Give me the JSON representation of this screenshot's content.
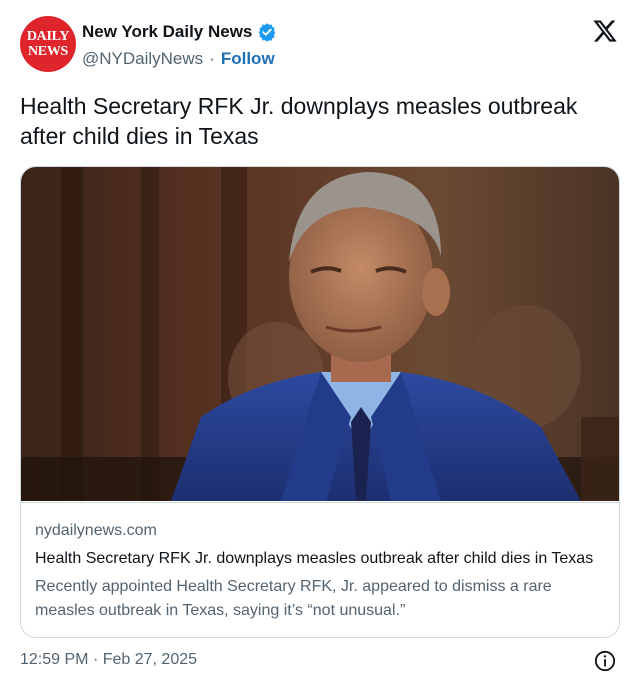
{
  "author": {
    "avatar_line1": "DAILY",
    "avatar_line2": "NEWS",
    "name": "New York Daily News",
    "handle": "@NYDailyNews",
    "separator": "·",
    "follow_label": "Follow"
  },
  "tweet": {
    "text": "Health Secretary RFK Jr. downplays measles outbreak after child dies in Texas"
  },
  "card": {
    "domain": "nydailynews.com",
    "title": "Health Secretary RFK Jr. downplays measles outbreak after child dies in Texas",
    "description": "Recently appointed Health Secretary RFK, Jr. appeared to dismiss a rare measles outbreak in Texas, saying it’s “not unusual.”"
  },
  "footer": {
    "time": "12:59 PM",
    "separator": "·",
    "date": "Feb 27, 2025"
  },
  "icons": {
    "verified": "verified-badge-icon",
    "platform": "x-logo-icon",
    "info": "info-icon"
  },
  "colors": {
    "brand_red": "#e0242b",
    "verified_blue": "#1d9bf0",
    "follow_blue": "#1d6fb8",
    "secondary_text": "#536471"
  }
}
